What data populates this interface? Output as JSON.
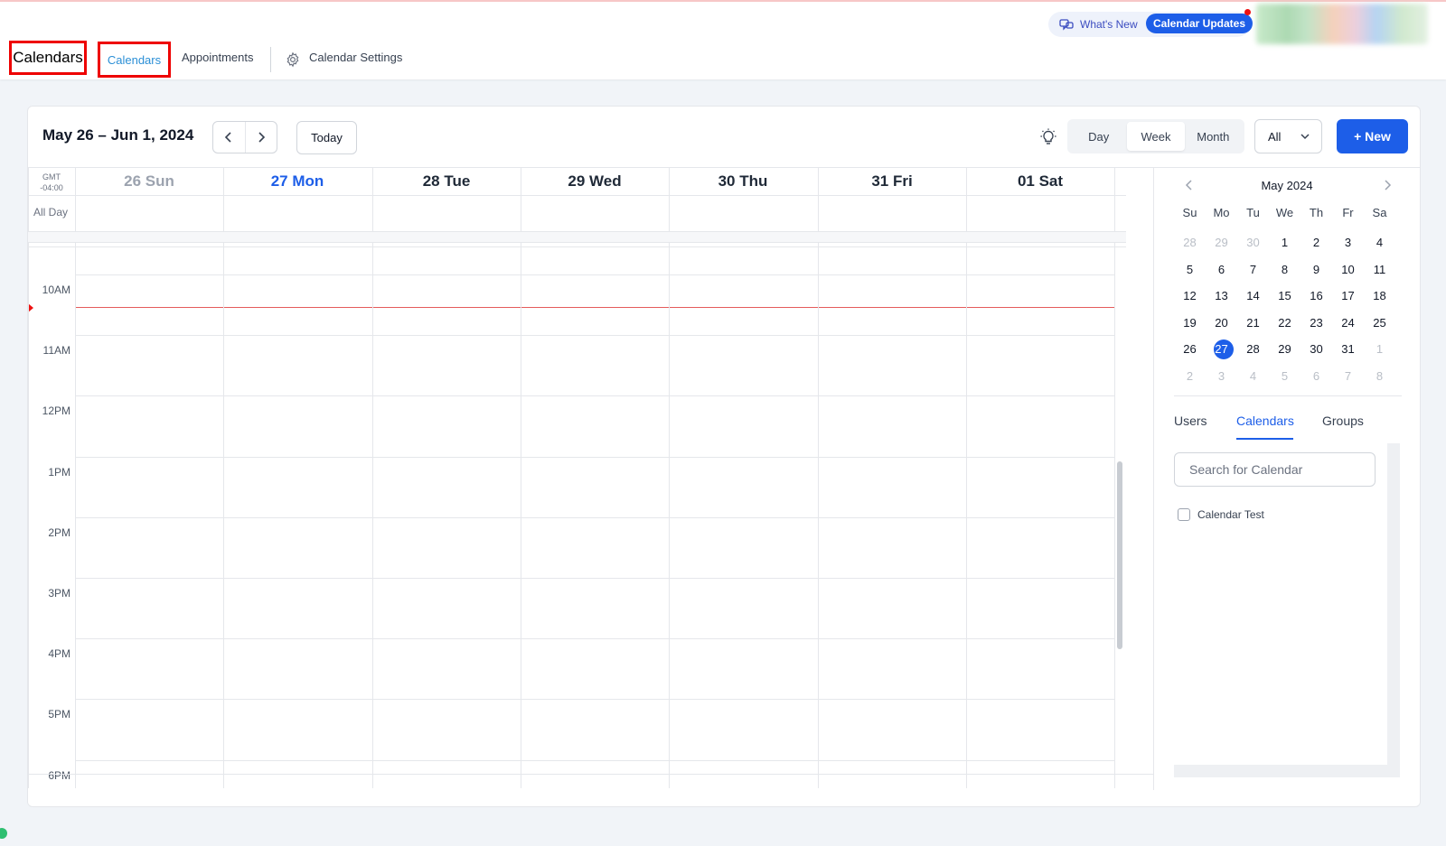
{
  "header": {
    "page_title": "Calendars",
    "tabs": [
      "Calendars",
      "Appointments",
      "Calendar Settings"
    ],
    "whats_new": "What's New",
    "updates_badge": "Calendar Updates"
  },
  "toolbar": {
    "date_range": "May 26 – Jun 1, 2024",
    "prev": "‹",
    "next": "›",
    "today": "Today",
    "views": [
      "Day",
      "Week",
      "Month"
    ],
    "active_view": "Week",
    "filter": "All",
    "new_button": "+ New"
  },
  "grid": {
    "timezone_line1": "GMT",
    "timezone_line2": "-04:00",
    "all_day": "All Day",
    "days": [
      {
        "label": "26 Sun",
        "color": "#9ca3af"
      },
      {
        "label": "27 Mon",
        "color": "#1d5ee8"
      },
      {
        "label": "28 Tue",
        "color": "#1f2937"
      },
      {
        "label": "29 Wed",
        "color": "#1f2937"
      },
      {
        "label": "30 Thu",
        "color": "#1f2937"
      },
      {
        "label": "31 Fri",
        "color": "#1f2937"
      },
      {
        "label": "01 Sat",
        "color": "#1f2937"
      }
    ],
    "hours": [
      "10AM",
      "11AM",
      "12PM",
      "1PM",
      "2PM",
      "3PM",
      "4PM",
      "5PM",
      "6PM"
    ]
  },
  "mini_calendar": {
    "title": "May 2024",
    "dow": [
      "Su",
      "Mo",
      "Tu",
      "We",
      "Th",
      "Fr",
      "Sa"
    ],
    "weeks": [
      [
        "28",
        "29",
        "30",
        "1",
        "2",
        "3",
        "4"
      ],
      [
        "5",
        "6",
        "7",
        "8",
        "9",
        "10",
        "11"
      ],
      [
        "12",
        "13",
        "14",
        "15",
        "16",
        "17",
        "18"
      ],
      [
        "19",
        "20",
        "21",
        "22",
        "23",
        "24",
        "25"
      ],
      [
        "26",
        "27",
        "28",
        "29",
        "30",
        "31",
        "1"
      ],
      [
        "2",
        "3",
        "4",
        "5",
        "6",
        "7",
        "8"
      ]
    ],
    "selected": "27"
  },
  "side_panel": {
    "tabs": [
      "Users",
      "Calendars",
      "Groups"
    ],
    "active_tab": "Calendars",
    "search_placeholder": "Search for Calendar",
    "calendars": [
      "Calendar Test"
    ]
  },
  "colors": {
    "accent": "#1d5ee8",
    "highlight_box": "#e00000",
    "now_line": "#e45b5b"
  }
}
